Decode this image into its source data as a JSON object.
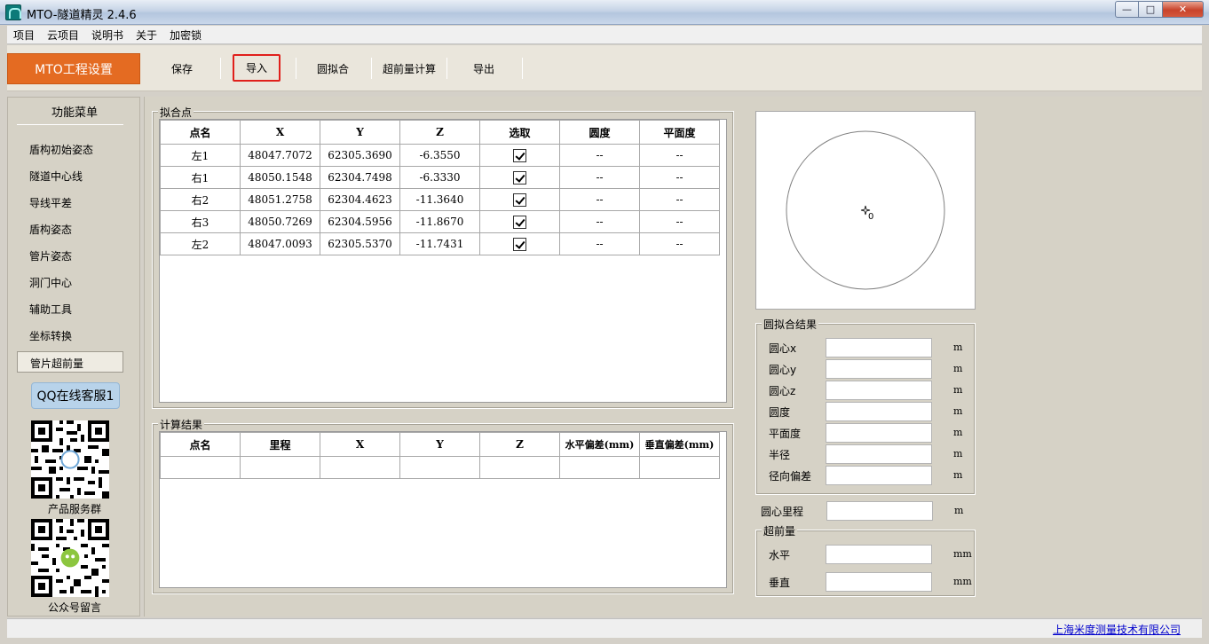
{
  "window": {
    "title": "MTO-隧道精灵 2.4.6"
  },
  "menu": [
    "项目",
    "云项目",
    "说明书",
    "关于",
    "加密锁"
  ],
  "toolbar": {
    "brand": "MTO工程设置",
    "save": "保存",
    "import": "导入",
    "circle_fit": "圆拟合",
    "overbreak_calc": "超前量计算",
    "export": "导出"
  },
  "sidebar": {
    "title": "功能菜单",
    "items": [
      "盾构初始姿态",
      "隧道中心线",
      "导线平差",
      "盾构姿态",
      "管片姿态",
      "洞门中心",
      "辅助工具",
      "坐标转换",
      "管片超前量"
    ],
    "qq_button": "QQ在线客服1",
    "qr1_label": "产品服务群",
    "qr2_label": "公众号留言"
  },
  "fit_points": {
    "legend": "拟合点",
    "columns": [
      "点名",
      "X",
      "Y",
      "Z",
      "选取",
      "圆度",
      "平面度"
    ],
    "rows": [
      {
        "name": "左1",
        "x": "48047.7072",
        "y": "62305.3690",
        "z": "-6.3550",
        "selected": true,
        "roundness": "--",
        "flatness": "--"
      },
      {
        "name": "右1",
        "x": "48050.1548",
        "y": "62304.7498",
        "z": "-6.3330",
        "selected": true,
        "roundness": "--",
        "flatness": "--"
      },
      {
        "name": "右2",
        "x": "48051.2758",
        "y": "62304.4623",
        "z": "-11.3640",
        "selected": true,
        "roundness": "--",
        "flatness": "--"
      },
      {
        "name": "右3",
        "x": "48050.7269",
        "y": "62304.5956",
        "z": "-11.8670",
        "selected": true,
        "roundness": "--",
        "flatness": "--"
      },
      {
        "name": "左2",
        "x": "48047.0093",
        "y": "62305.5370",
        "z": "-11.7431",
        "selected": true,
        "roundness": "--",
        "flatness": "--"
      }
    ]
  },
  "calc_results": {
    "legend": "计算结果",
    "columns": [
      "点名",
      "里程",
      "X",
      "Y",
      "Z",
      "水平偏差(mm)",
      "垂直偏差(mm)"
    ]
  },
  "preview": {
    "center_label": "0"
  },
  "circle_result": {
    "legend": "圆拟合结果",
    "fields": [
      {
        "label": "圆心x",
        "unit": "m",
        "value": ""
      },
      {
        "label": "圆心y",
        "unit": "m",
        "value": ""
      },
      {
        "label": "圆心z",
        "unit": "m",
        "value": ""
      },
      {
        "label": "圆度",
        "unit": "m",
        "value": ""
      },
      {
        "label": "平面度",
        "unit": "m",
        "value": ""
      },
      {
        "label": "半径",
        "unit": "m",
        "value": ""
      },
      {
        "label": "径向偏差",
        "unit": "m",
        "value": ""
      }
    ]
  },
  "center_mileage": {
    "label": "圆心里程",
    "unit": "m",
    "value": ""
  },
  "overbreak": {
    "legend": "超前量",
    "horizontal": {
      "label": "水平",
      "unit": "mm",
      "value": ""
    },
    "vertical": {
      "label": "垂直",
      "unit": "mm",
      "value": ""
    }
  },
  "status": {
    "company": "上海米度测量技术有限公司"
  }
}
